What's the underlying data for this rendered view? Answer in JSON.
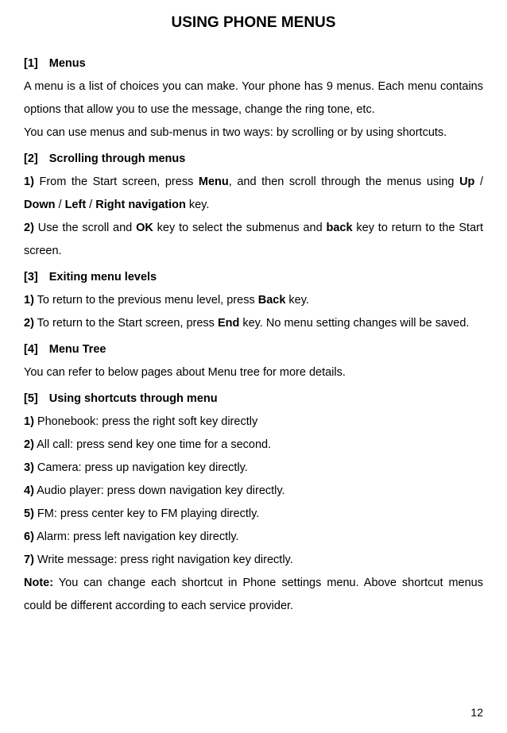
{
  "title": "USING PHONE MENUS",
  "page_number": "12",
  "sections": {
    "s1": {
      "bracket": "[1]",
      "heading": "Menus",
      "p1": "A menu is a list of choices you can make. Your phone has 9 menus. Each menu contains options that allow you to use the message, change the ring tone, etc.",
      "p2": "You can use menus and sub-menus in two ways: by scrolling or by using shortcuts."
    },
    "s2": {
      "bracket": "[2]",
      "heading": "Scrolling through menus",
      "p1_before": "1)",
      "p1_a": " From the Start screen, press ",
      "p1_menu": "Menu",
      "p1_b": ", and then scroll through the menus using ",
      "p1_up": "Up",
      "p1_slash1": " / ",
      "p1_down": "Down",
      "p1_slash2": " / ",
      "p1_left": "Left",
      "p1_slash3": " / ",
      "p1_right": "Right navigation",
      "p1_c": " key.",
      "p2_before": "2)",
      "p2_a": " Use the scroll and ",
      "p2_ok": "OK",
      "p2_b": " key to select the submenus and ",
      "p2_back": "back",
      "p2_c": " key to return to the Start screen."
    },
    "s3": {
      "bracket": "[3]",
      "heading": "Exiting menu levels",
      "p1_before": "1)",
      "p1_a": " To return to the previous menu level, press ",
      "p1_back": "Back",
      "p1_b": " key.",
      "p2_before": "2)",
      "p2_a": " To return to the Start screen, press ",
      "p2_end": "End",
      "p2_b": " key. No menu setting changes will be saved."
    },
    "s4": {
      "bracket": "[4]",
      "heading": "Menu Tree",
      "p1": "You can refer to below pages about Menu tree for more details."
    },
    "s5": {
      "bracket": "[5]",
      "heading": "Using shortcuts through menu",
      "i1_b": "1)",
      "i1_t": " Phonebook: press the right soft key directly",
      "i2_b": "2)",
      "i2_t": " All call: press send key one time for a second.",
      "i3_b": "3)",
      "i3_t": " Camera: press up navigation key directly.",
      "i4_b": "4)",
      "i4_t": " Audio player: press down navigation key directly.",
      "i5_b": "5)",
      "i5_t": " FM:  press center key to FM  playing  directly.",
      "i6_b": "6)",
      "i6_t": " Alarm: press left navigation key directly.",
      "i7_b": "7)",
      "i7_t": " Write message: press right navigation key directly.",
      "note_b": "Note:",
      "note_t": "  You can change each shortcut in Phone settings menu. Above shortcut menus could be different according to each service provider."
    }
  }
}
